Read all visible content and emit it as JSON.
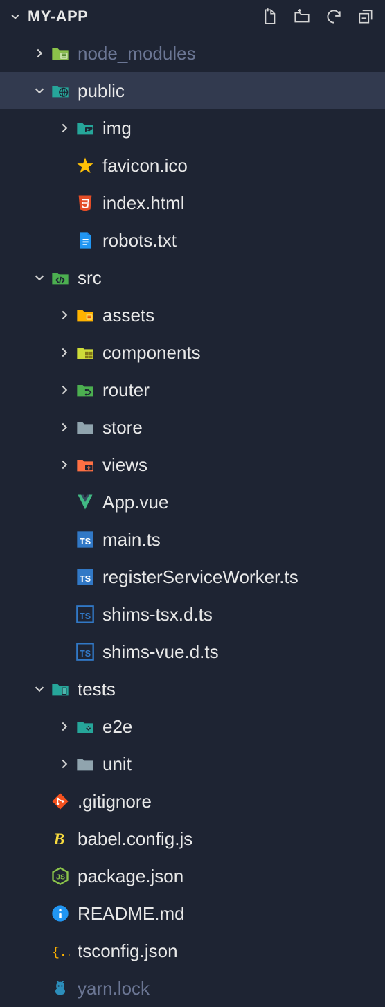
{
  "header": {
    "title": "MY-APP"
  },
  "tree": {
    "items": [
      {
        "label": "node_modules",
        "type": "folder",
        "icon": "folder-node",
        "indent": 1,
        "chevron": "right",
        "dimmed": true
      },
      {
        "label": "public",
        "type": "folder",
        "icon": "folder-public",
        "indent": 1,
        "chevron": "down",
        "selected": true
      },
      {
        "label": "img",
        "type": "folder",
        "icon": "folder-img",
        "indent": 2,
        "chevron": "right"
      },
      {
        "label": "favicon.ico",
        "type": "file",
        "icon": "favicon",
        "indent": 2
      },
      {
        "label": "index.html",
        "type": "file",
        "icon": "html",
        "indent": 2
      },
      {
        "label": "robots.txt",
        "type": "file",
        "icon": "txt",
        "indent": 2
      },
      {
        "label": "src",
        "type": "folder",
        "icon": "folder-src",
        "indent": 1,
        "chevron": "down"
      },
      {
        "label": "assets",
        "type": "folder",
        "icon": "folder-assets",
        "indent": 2,
        "chevron": "right"
      },
      {
        "label": "components",
        "type": "folder",
        "icon": "folder-components",
        "indent": 2,
        "chevron": "right"
      },
      {
        "label": "router",
        "type": "folder",
        "icon": "folder-router",
        "indent": 2,
        "chevron": "right"
      },
      {
        "label": "store",
        "type": "folder",
        "icon": "folder",
        "indent": 2,
        "chevron": "right"
      },
      {
        "label": "views",
        "type": "folder",
        "icon": "folder-views",
        "indent": 2,
        "chevron": "right"
      },
      {
        "label": "App.vue",
        "type": "file",
        "icon": "vue",
        "indent": 2
      },
      {
        "label": "main.ts",
        "type": "file",
        "icon": "ts",
        "indent": 2
      },
      {
        "label": "registerServiceWorker.ts",
        "type": "file",
        "icon": "ts",
        "indent": 2
      },
      {
        "label": "shims-tsx.d.ts",
        "type": "file",
        "icon": "dts",
        "indent": 2
      },
      {
        "label": "shims-vue.d.ts",
        "type": "file",
        "icon": "dts",
        "indent": 2
      },
      {
        "label": "tests",
        "type": "folder",
        "icon": "folder-tests",
        "indent": 1,
        "chevron": "down"
      },
      {
        "label": "e2e",
        "type": "folder",
        "icon": "folder-e2e",
        "indent": 2,
        "chevron": "right"
      },
      {
        "label": "unit",
        "type": "folder",
        "icon": "folder",
        "indent": 2,
        "chevron": "right"
      },
      {
        "label": ".gitignore",
        "type": "file",
        "icon": "git",
        "indent": 1
      },
      {
        "label": "babel.config.js",
        "type": "file",
        "icon": "babel",
        "indent": 1
      },
      {
        "label": "package.json",
        "type": "file",
        "icon": "nodejs",
        "indent": 1
      },
      {
        "label": "README.md",
        "type": "file",
        "icon": "readme",
        "indent": 1
      },
      {
        "label": "tsconfig.json",
        "type": "file",
        "icon": "tsconfig",
        "indent": 1
      },
      {
        "label": "yarn.lock",
        "type": "file",
        "icon": "yarn",
        "indent": 1,
        "dimmed": true
      }
    ]
  }
}
